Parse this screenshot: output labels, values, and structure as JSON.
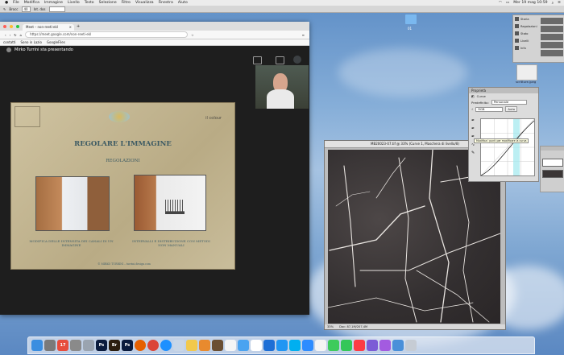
{
  "menubar": {
    "items": [
      "File",
      "Modifica",
      "Immagine",
      "Livello",
      "Testo",
      "Selezione",
      "Filtro",
      "Visualizza",
      "Finestra",
      "Aiuto"
    ],
    "clock": "Mer 19 mag  10:59"
  },
  "ps_options": {
    "label": "Brocc",
    "value": "40",
    "label2": "Int. dos"
  },
  "desktop": {
    "folder_label": "01",
    "file_label": "scritture.jpeg"
  },
  "browser": {
    "tab_title": "Meet – non-reeti-ekl",
    "url": "https://meet.google.com/non-reeti-ekl",
    "bookmarks": [
      "contatti",
      "Sono in Lazio",
      "GoogleFiles"
    ],
    "presenter": "Mirko Turrini sta presentando"
  },
  "slide": {
    "title": "REGOLARE L'IMMAGINE",
    "subtitle": "REGOLAZIONI",
    "logo": "il colour",
    "caption_left": "MODIFICA DELLE INTENSITA DEI CANALI DI UN IMMAGINE",
    "caption_right": "INTERVALLI E DISTRIBUZIONE CON METODI NON MANUALI",
    "footer": "© MIRKO TURRINI – turrini.design.com"
  },
  "doc_window": {
    "title": "MB20023-07.tif @ 33% (Curve 1, Maschera di livello/8)",
    "status_zoom": "33%",
    "status_info": "Doc: 87,1M/207,4M"
  },
  "properties": {
    "header": "Proprietà",
    "panel_name": "Curve",
    "preset_label": "Predefinito:",
    "preset_value": "Personale",
    "channel_value": "RGB",
    "auto_label": "Auto",
    "tooltip": "Modifica i punti per modificare la curva"
  },
  "right_panel": {
    "items": [
      "Storia",
      "Regolazioni",
      "Stato",
      "Livelli",
      "Info"
    ]
  },
  "dock": {
    "icons": [
      {
        "name": "finder",
        "color": "#3b8ee0",
        "glyph": ""
      },
      {
        "name": "launchpad",
        "color": "#7a7a7a",
        "glyph": ""
      },
      {
        "name": "calendar",
        "color": "#e74c3c",
        "glyph": "17"
      },
      {
        "name": "system-preferences",
        "color": "#8a8a8a",
        "glyph": ""
      },
      {
        "name": "rocket",
        "color": "#9aa4b0",
        "glyph": ""
      },
      {
        "name": "photoshop",
        "color": "#0a1b3d",
        "glyph": "Ps"
      },
      {
        "name": "bridge",
        "color": "#2b1d0e",
        "glyph": "Br"
      },
      {
        "name": "photoshop-2",
        "color": "#0a1b3d",
        "glyph": "Ps"
      },
      {
        "name": "firefox",
        "color": "#e66000",
        "glyph": ""
      },
      {
        "name": "chrome",
        "color": "#db4437",
        "glyph": ""
      },
      {
        "name": "safari",
        "color": "#1e90ff",
        "glyph": ""
      },
      {
        "name": "preview",
        "color": "#c9d6e6",
        "glyph": ""
      },
      {
        "name": "notes",
        "color": "#f2c94c",
        "glyph": ""
      },
      {
        "name": "books",
        "color": "#e88a2e",
        "glyph": ""
      },
      {
        "name": "dictionary",
        "color": "#6b4f33",
        "glyph": ""
      },
      {
        "name": "textedit",
        "color": "#f5f5f5",
        "glyph": ""
      },
      {
        "name": "mail",
        "color": "#4aa3f0",
        "glyph": ""
      },
      {
        "name": "pages",
        "color": "#ffffff",
        "glyph": ""
      },
      {
        "name": "keynote",
        "color": "#1e6fd6",
        "glyph": ""
      },
      {
        "name": "app-store",
        "color": "#2196f3",
        "glyph": ""
      },
      {
        "name": "skype",
        "color": "#00aff0",
        "glyph": ""
      },
      {
        "name": "zoom",
        "color": "#2d8cff",
        "glyph": ""
      },
      {
        "name": "photos",
        "color": "#f4f4f4",
        "glyph": ""
      },
      {
        "name": "messages",
        "color": "#3ecb5c",
        "glyph": ""
      },
      {
        "name": "facetime",
        "color": "#34c759",
        "glyph": ""
      },
      {
        "name": "music",
        "color": "#fc3c44",
        "glyph": ""
      },
      {
        "name": "app-folder",
        "color": "#7c5cd6",
        "glyph": ""
      },
      {
        "name": "podcasts",
        "color": "#a35be0",
        "glyph": ""
      },
      {
        "name": "screen-sharing",
        "color": "#4a90d9",
        "glyph": ""
      },
      {
        "name": "trash",
        "color": "#c6ccd4",
        "glyph": ""
      }
    ]
  }
}
